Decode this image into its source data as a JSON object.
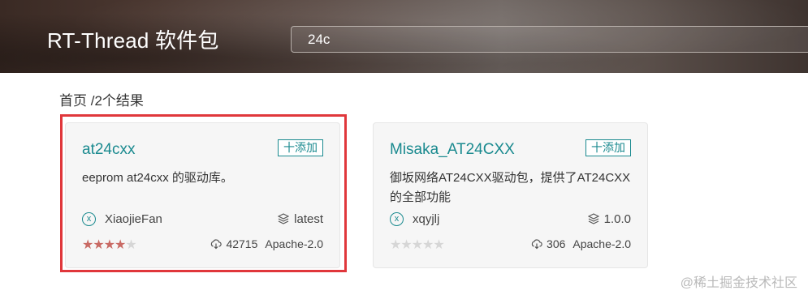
{
  "header": {
    "logo": "RT-Thread 软件包",
    "search_value": "24c"
  },
  "breadcrumb": "首页 /2个结果",
  "packages": [
    {
      "name": "at24cxx",
      "add_label": "十添加",
      "description": "eeprom at24cxx 的驱动库。",
      "author_icon": "x",
      "author": "XiaojieFan",
      "version": "latest",
      "rating": 4,
      "rating_max": 5,
      "downloads": "42715",
      "license": "Apache-2.0"
    },
    {
      "name": "Misaka_AT24CXX",
      "add_label": "十添加",
      "description": "御坂网络AT24CXX驱动包，提供了AT24CXX的全部功能",
      "author_icon": "x",
      "author": "xqyjlj",
      "version": "1.0.0",
      "rating": 0,
      "rating_max": 5,
      "downloads": "306",
      "license": "Apache-2.0"
    }
  ],
  "colors": {
    "accent": "#1a8a8f",
    "highlight": "#e0373b",
    "star_on": "#c96a64",
    "star_off": "#d6d6d6"
  },
  "watermark": "@稀土掘金技术社区"
}
